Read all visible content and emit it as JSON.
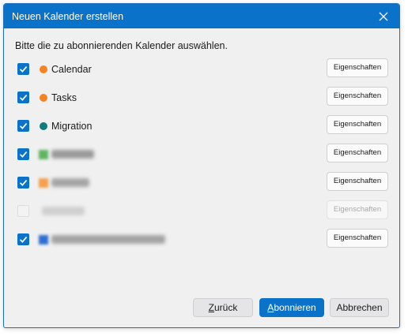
{
  "window": {
    "title": "Neuen Kalender erstellen"
  },
  "instruction": "Bitte die zu abonnierenden Kalender auswählen.",
  "calendars": [
    {
      "name": "Calendar",
      "color": "#f5831f",
      "checked": true,
      "obscured": false,
      "properties_label": "Eigenschaften",
      "properties_enabled": true
    },
    {
      "name": "Tasks",
      "color": "#f5831f",
      "checked": true,
      "obscured": false,
      "properties_label": "Eigenschaften",
      "properties_enabled": true
    },
    {
      "name": "Migration",
      "color": "#0e7c7b",
      "checked": true,
      "obscured": false,
      "properties_label": "Eigenschaften",
      "properties_enabled": true
    },
    {
      "name": "",
      "color": "#5fb55f",
      "checked": true,
      "obscured": true,
      "properties_label": "Eigenschaften",
      "properties_enabled": true
    },
    {
      "name": "",
      "color": "#f5a04a",
      "checked": true,
      "obscured": true,
      "properties_label": "Eigenschaften",
      "properties_enabled": true
    },
    {
      "name": "",
      "color": "",
      "checked": false,
      "obscured": true,
      "properties_label": "Eigenschaften",
      "properties_enabled": false
    },
    {
      "name": "",
      "color": "#2e6fd1",
      "checked": true,
      "obscured": true,
      "properties_label": "Eigenschaften",
      "properties_enabled": true
    }
  ],
  "buttons": {
    "back_mnemonic": "Z",
    "back_rest": "urück",
    "subscribe_mnemonic": "A",
    "subscribe_rest": "bonnieren",
    "cancel": "Abbrechen"
  },
  "colors": {
    "accent": "#0a72c9",
    "background": "#f0f0f1"
  },
  "icons": {
    "close": "close-icon",
    "check": "checkmark-icon"
  }
}
